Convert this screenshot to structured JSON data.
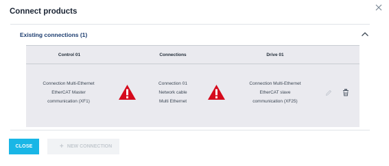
{
  "dialog": {
    "title": "Connect products",
    "close_icon": "close-icon"
  },
  "section": {
    "title": "Existing connections (1)",
    "expanded": true
  },
  "table": {
    "headers": [
      "Control 01",
      "Connections",
      "Drive 01"
    ],
    "rows": [
      {
        "control": [
          "Connection Multi-Ethernet",
          "EtherCAT Master",
          "communication (XF1)"
        ],
        "connection": [
          "Connection 01",
          "Network cable",
          "Multi Ethernet"
        ],
        "drive": [
          "Connection Multi-Ethernet",
          "EtherCAT slave",
          "communication (XF25)"
        ],
        "status_icon": "warning-icon",
        "edit_enabled": false
      }
    ]
  },
  "footer": {
    "close_label": "CLOSE",
    "new_connection_label": "NEW CONNECTION",
    "new_connection_enabled": false
  },
  "colors": {
    "primary": "#19b6e6",
    "warning": "#d50a1c",
    "section_title": "#1a3b6e",
    "table_bg": "#eaeaef"
  }
}
